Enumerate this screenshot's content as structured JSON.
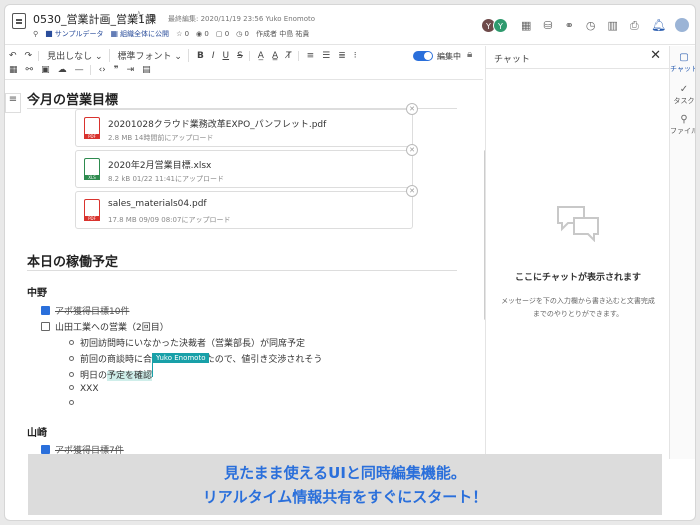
{
  "header": {
    "title": "0530_営業計画_営業1課",
    "last_edit": "最終編集: 2020/11/19 23:56 Yuko Enomoto",
    "meta": {
      "sample_data": "サンプルデータ",
      "scope": "組織全体に公開",
      "stars": "0",
      "views": "0",
      "comments": "0",
      "edits": "0",
      "author": "作成者 中島 祐貴"
    },
    "avatars": [
      "Y",
      "Y"
    ]
  },
  "toolbar": {
    "heading_select": "見出しなし",
    "font_select": "標準フォント",
    "bold": "B",
    "italic": "I",
    "underline": "U",
    "strike": "S",
    "edit_mode_label": "編集中"
  },
  "editor": {
    "section1_title": "今月の営業目標",
    "files": [
      {
        "name": "20201028クラウド業務改革EXPO_パンフレット.pdf",
        "meta": "2.8 MB   14時間前にアップロード",
        "type": "pdf"
      },
      {
        "name": "2020年2月営業目標.xlsx",
        "meta": "8.2 kB   01/22 11:41にアップロード",
        "type": "xls"
      },
      {
        "name": "sales_materials04.pdf",
        "meta": "17.8 MB   09/09 08:07にアップロード",
        "type": "pdf"
      }
    ],
    "section2_title": "本日の稼働予定",
    "person1": "中野",
    "task1": "アポ獲得目標10件",
    "task2": "山田工業への営業（2回目）",
    "sub1": "初回訪問時にいなかった決裁者（営業部長）が同席予定",
    "sub2": "前回の商談時に合意を取れていたので、値引き交渉されそう",
    "sub3_prefix": "明日の",
    "sub3_highlight": "予定を確認",
    "sub4": "XXX",
    "cursor_user": "Yuko Enomoto",
    "person2": "山崎",
    "task3": "アポ獲得目標7件"
  },
  "chat": {
    "title": "チャット",
    "empty_title": "ここにチャットが表示されます",
    "hint": "メッセージを下の入力欄から書き込むと文書完成までのやりとりができます。"
  },
  "rail": {
    "chat": "チャット",
    "task": "タスク",
    "file": "ファイル"
  },
  "banner": {
    "line1": "見たまま使えるUIと同時編集機能。",
    "line2": "リアルタイム情報共有をすぐにスタート！"
  },
  "colors": {
    "accent": "#2a6fdb",
    "cursor": "#18a0a8",
    "highlight": "#cfeeea"
  }
}
